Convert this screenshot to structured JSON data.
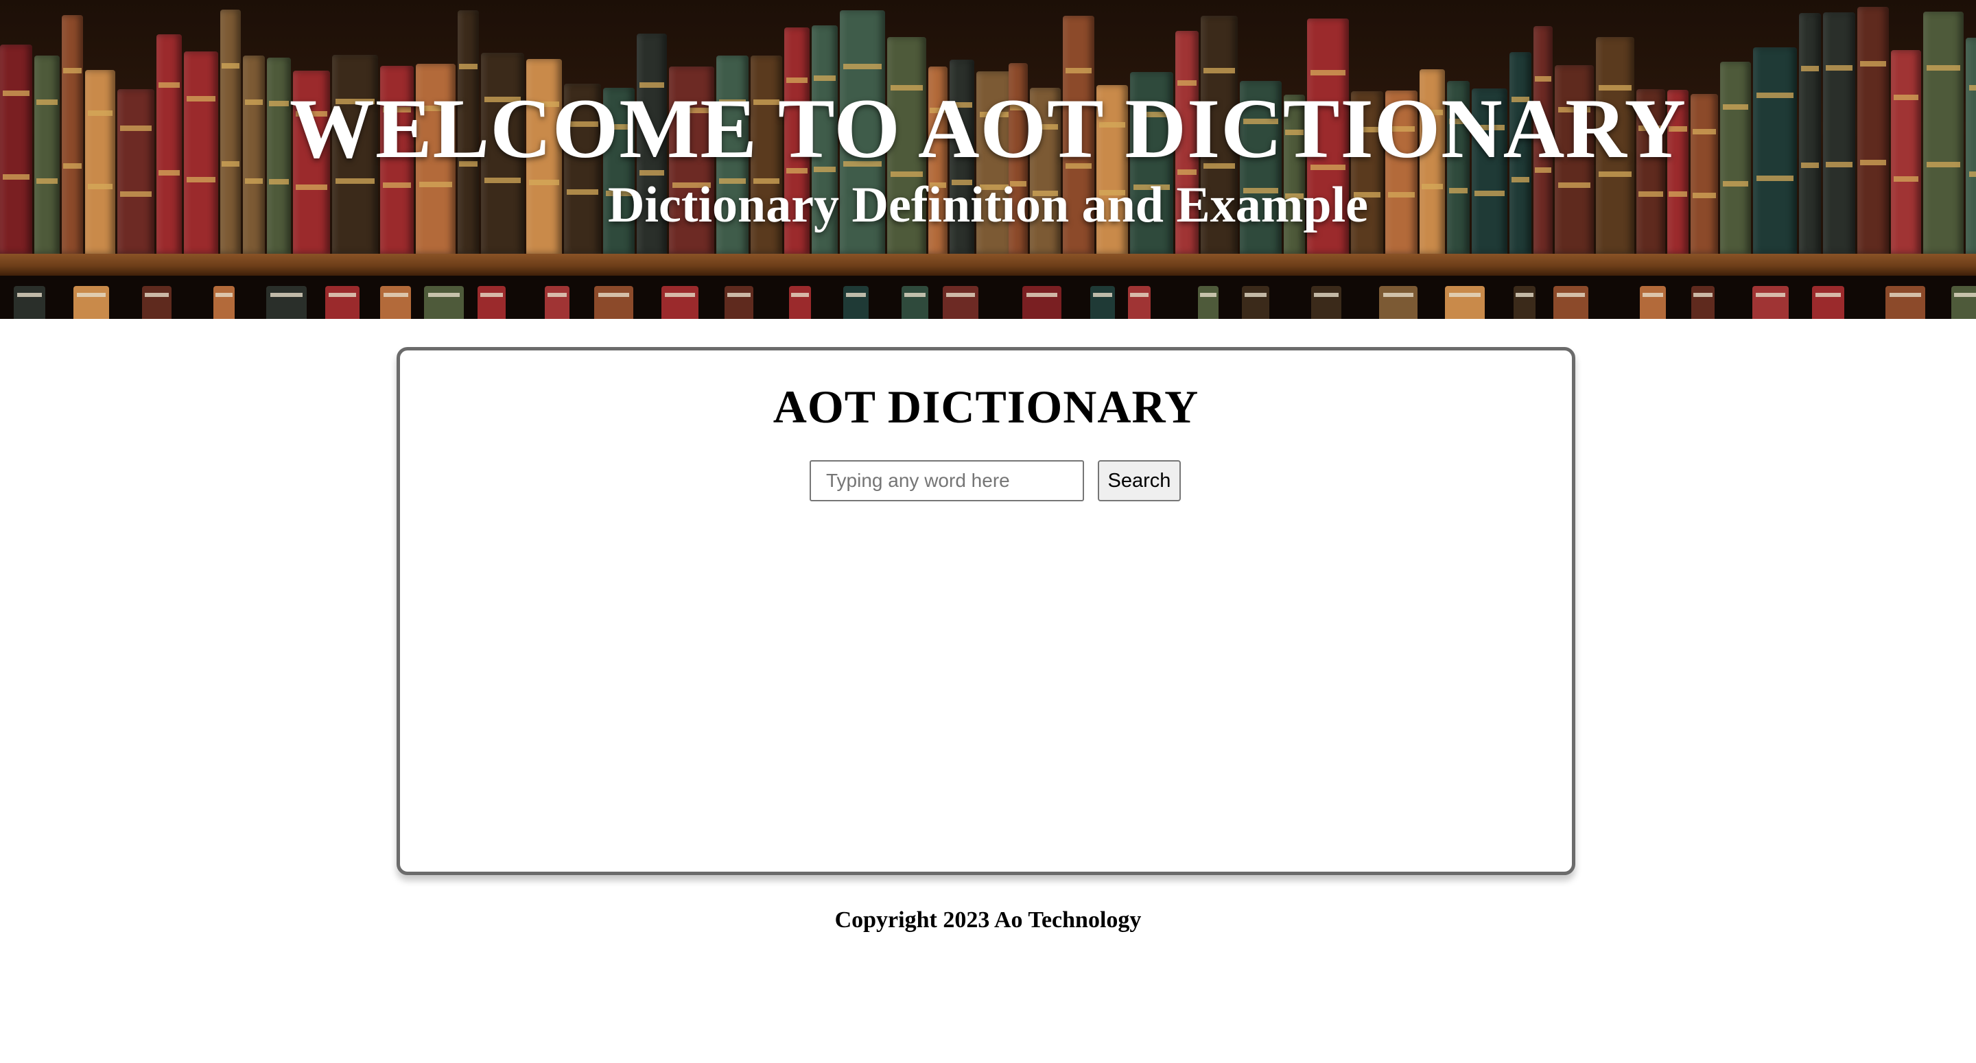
{
  "hero": {
    "title": "WELCOME TO AOT DICTIONARY",
    "subtitle": "Dictionary Definition and Example"
  },
  "card": {
    "title": "AOT DICTIONARY",
    "search": {
      "placeholder": "Typing any word here",
      "value": "",
      "button_label": "Search"
    }
  },
  "footer": {
    "copyright": "Copyright 2023 Ao Technology"
  },
  "colors": {
    "card_border": "#6b6b6b",
    "button_bg": "#efefef",
    "hero_text": "#ffffff"
  }
}
